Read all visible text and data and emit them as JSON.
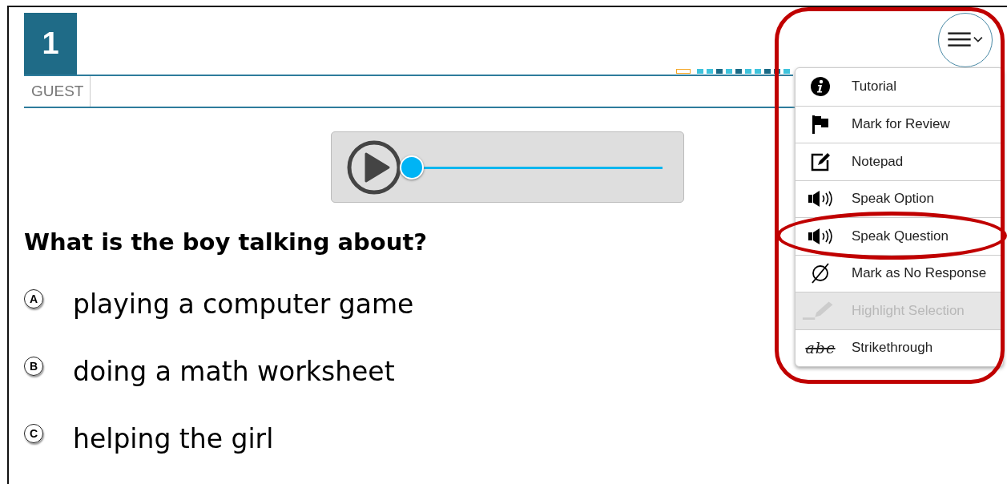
{
  "question_number": "1",
  "user": "GUEST",
  "progress": [
    {
      "color": "#f5a623",
      "current": true
    },
    {
      "color": "#3ec3dc",
      "current": false
    },
    {
      "color": "#3ec3dc",
      "current": false
    },
    {
      "color": "#1a6a86",
      "current": false
    },
    {
      "color": "#3ec3dc",
      "current": false
    },
    {
      "color": "#1a6a86",
      "current": false
    },
    {
      "color": "#3ec3dc",
      "current": false
    },
    {
      "color": "#3ec3dc",
      "current": false
    },
    {
      "color": "#1a6a86",
      "current": false
    },
    {
      "color": "#1a6a86",
      "current": false
    },
    {
      "color": "#3ec3dc",
      "current": false
    }
  ],
  "question": "What is the boy talking about?",
  "options": [
    {
      "letter": "A",
      "text": "playing a computer game"
    },
    {
      "letter": "B",
      "text": "doing a math worksheet"
    },
    {
      "letter": "C",
      "text": "helping the girl"
    }
  ],
  "menu": {
    "expanded": true,
    "items": [
      {
        "kind": "info",
        "label": "Tutorial",
        "disabled": false,
        "circled": false
      },
      {
        "kind": "flag",
        "label": "Mark for Review",
        "disabled": false,
        "circled": false
      },
      {
        "kind": "notepad",
        "label": "Notepad",
        "disabled": false,
        "circled": false
      },
      {
        "kind": "speaker",
        "label": "Speak Option",
        "disabled": false,
        "circled": false
      },
      {
        "kind": "speaker",
        "label": "Speak Question",
        "disabled": false,
        "circled": true
      },
      {
        "kind": "empty",
        "label": "Mark as No Response",
        "disabled": false,
        "circled": false
      },
      {
        "kind": "highlighter",
        "label": "Highlight Selection",
        "disabled": true,
        "circled": false
      },
      {
        "kind": "strike",
        "label": "Strikethrough",
        "icon_text": "abc",
        "disabled": false,
        "circled": false
      }
    ]
  }
}
